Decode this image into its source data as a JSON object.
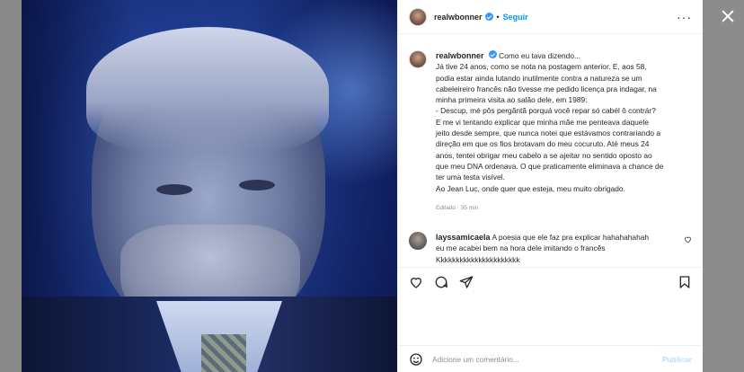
{
  "post": {
    "username": "realwbonner",
    "follow_label": "Seguir",
    "more_label": "···",
    "caption_lines": [
      "Como eu tava dizendo...",
      "Já tive 24 anos, como se nota na postagem anterior. E, aos 58,",
      "podia estar ainda lutando inutilmente contra a natureza se um",
      "cabeleireiro francês não tivesse me pedido licença pra indagar, na",
      "minha primeira visita ao salão dele, em 1989:",
      "- Descup, mé pôs pergãntã porquá você repar só cabél ô contrár?",
      "E me vi tentando explicar que minha mãe me penteava daquele",
      "jeito desde sempre, que nunca notei que estávamos contrariando a",
      "direção em que os fios brotavam do meu cocuruto. Até meus 24",
      "anos, tentei obrigar meu cabelo a se ajeitar no sentido oposto ao",
      "que meu DNA ordenava. O que praticamente eliminava a chance de",
      "ter uma testa visível.",
      "Ao Jean Luc, onde quer que esteja, meu muito obrigado."
    ],
    "meta": "Editado · 35 min"
  },
  "comment": {
    "username": "layssamicaela",
    "text_line1": "A poesia que ele faz pra explicar hahahahahah",
    "text_line2": "eu me acabei bem na hora dele imitando o francês",
    "text_line3": "Kkkkkkkkkkkkkkkkkkkkkk"
  },
  "composer": {
    "placeholder": "Adicione um comentário...",
    "post_label": "Publicar"
  },
  "icons": {
    "close": "close-icon",
    "like": "heart-icon",
    "comment": "comment-icon",
    "share": "send-icon",
    "save": "bookmark-icon",
    "emoji": "emoji-icon",
    "comment_like": "small-heart-icon"
  }
}
